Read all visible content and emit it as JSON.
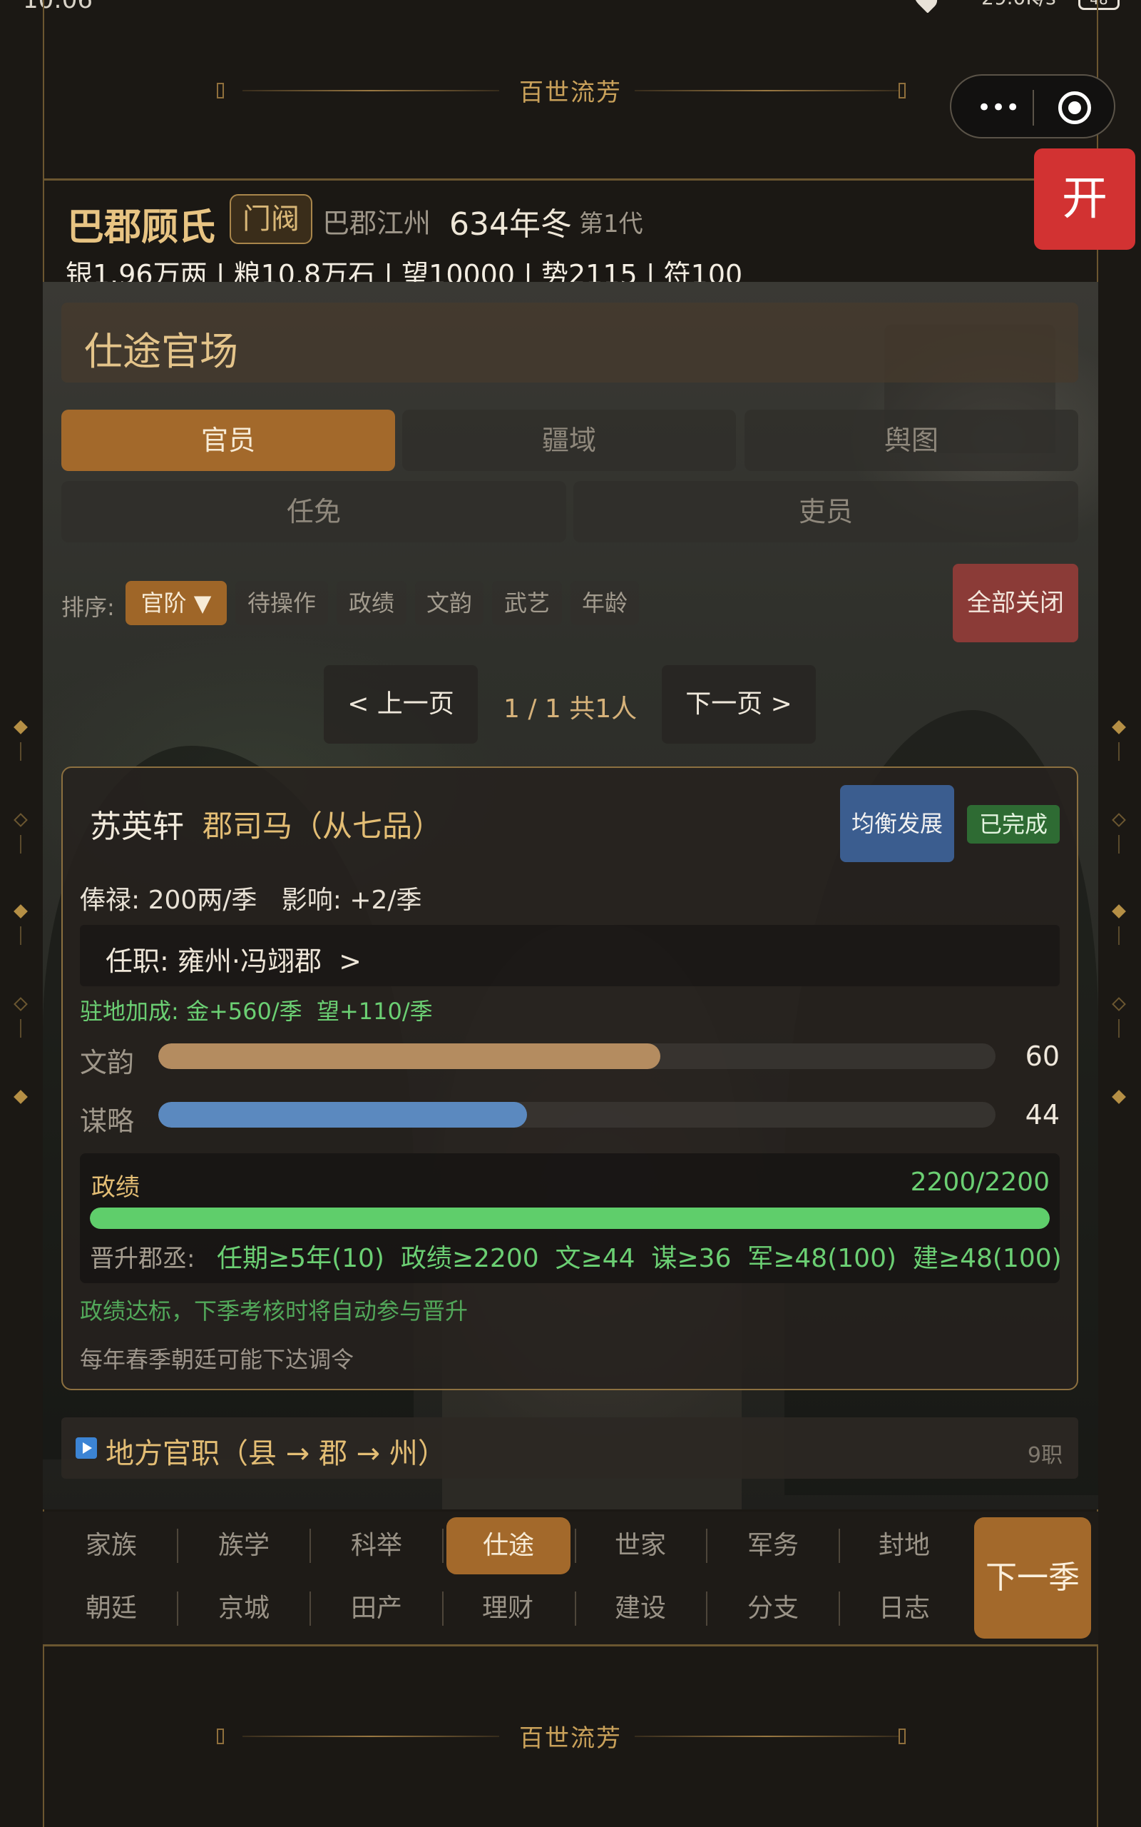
{
  "status_bar": {
    "time": "10:06",
    "net_speed": "29.0K/s",
    "battery": "48"
  },
  "header_deco": {
    "title": "百世流芳"
  },
  "footer_deco": {
    "title": "百世流芳"
  },
  "capsule": {
    "more_icon": "more-dots-icon",
    "close_icon": "target-icon"
  },
  "open_button": "开",
  "family": {
    "name": "巴郡顾氏",
    "rank_badge": "门阀",
    "place": "巴郡江州",
    "year": "634年冬",
    "generation": "第1代",
    "resources": "银1.96万两 | 粮10.8万石 | 望10000 | 势2115 | 符100"
  },
  "section_title": "仕途官场",
  "tabs_row1": [
    {
      "label": "官员",
      "active": true
    },
    {
      "label": "疆域",
      "active": false
    },
    {
      "label": "舆图",
      "active": false
    }
  ],
  "tabs_row2": [
    {
      "label": "任免",
      "active": false
    },
    {
      "label": "吏员",
      "active": false
    }
  ],
  "sort": {
    "label": "排序:",
    "options": [
      "官阶 ▼",
      "待操作",
      "政绩",
      "文韵",
      "武艺",
      "年龄"
    ],
    "active_index": 0,
    "close_all": "全部关闭"
  },
  "pager": {
    "prev": "< 上一页",
    "info": "1 / 1  共1人",
    "next": "下一页 >"
  },
  "official": {
    "name": "苏英轩",
    "title": "郡司马（从七品）",
    "focus_badge": "均衡发展",
    "status_badge": "已完成",
    "salary": "俸禄: 200两/季   影响: +2/季",
    "office": "任职: 雍州·冯翊郡  >",
    "bonus": "驻地加成: 金+560/季  望+110/季",
    "stats": [
      {
        "label": "文韵",
        "value": "60",
        "fraction": 0.6,
        "color": "#b48c60"
      },
      {
        "label": "谋略",
        "value": "44",
        "fraction": 0.44,
        "color": "#5b89bf"
      }
    ],
    "merit": {
      "label": "政绩",
      "value": "2200/2200",
      "fraction": 1.0,
      "promotion_label": "晋升郡丞:",
      "promotion_requirements": "任期≥5年(10)  政绩≥2200  文≥44  谋≥36  军≥48(100)  建≥48(100)"
    },
    "promotion_note": "政绩达标，下季考核时将自动参与晋升",
    "yearly_note": "每年春季朝廷可能下达调令"
  },
  "local_offices": {
    "label": "地方官职（县 → 郡 → 州）",
    "count": "9职",
    "icon": "play-icon"
  },
  "nav_row1": [
    "家族",
    "族学",
    "科举",
    "仕途",
    "世家",
    "军务",
    "封地"
  ],
  "nav_row2": [
    "朝廷",
    "京城",
    "田产",
    "理财",
    "建设",
    "分支",
    "日志"
  ],
  "nav_active": "仕途",
  "next_season": "下一季",
  "colors": {
    "accent": "#a3692b",
    "gold": "#e3bd74",
    "green": "#6bcf73",
    "danger": "#d23232"
  }
}
